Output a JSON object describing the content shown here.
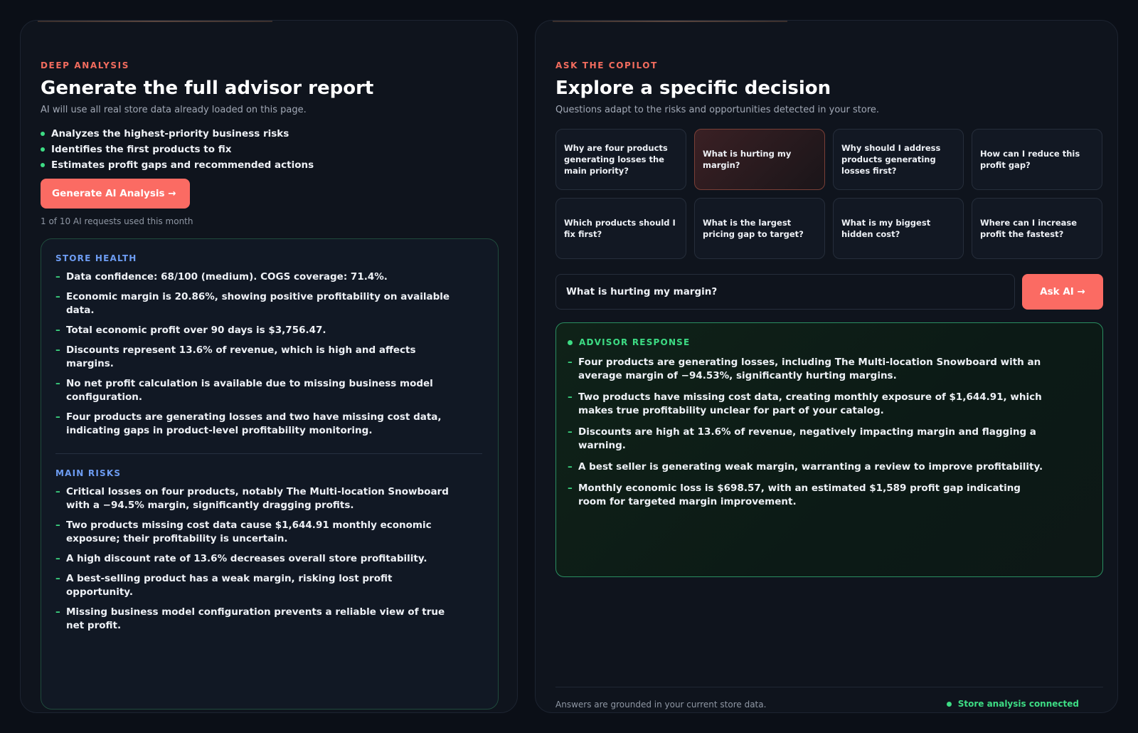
{
  "report": {
    "eyebrow": "DEEP ANALYSIS",
    "title": "Generate the full advisor report",
    "subtitle": "AI will use all real store data already loaded on this page.",
    "bullets": [
      "Analyzes the highest-priority business risks",
      "Identifies the first products to fix",
      "Estimates profit gaps and recommended actions"
    ],
    "generate_label": "Generate AI Analysis →",
    "usage": "1 of 10 AI requests used this month",
    "store_health": {
      "title": "STORE HEALTH",
      "items": [
        "Data confidence: 68/100 (medium). COGS coverage: 71.4%.",
        "Economic margin is 20.86%, showing positive profitability on available data.",
        "Total economic profit over 90 days is $3,756.47.",
        "Discounts represent 13.6% of revenue, which is high and affects margins.",
        "No net profit calculation is available due to missing business model configuration.",
        "Four products are generating losses and two have missing cost data, indicating gaps in product-level profitability monitoring."
      ]
    },
    "main_risks": {
      "title": "MAIN RISKS",
      "items": [
        "Critical losses on four products, notably The Multi-location Snowboard with a −94.5% margin, significantly dragging profits.",
        "Two products missing cost data cause $1,644.91 monthly economic exposure; their profitability is uncertain.",
        "A high discount rate of 13.6% decreases overall store profitability.",
        "A best-selling product has a weak margin, risking lost profit opportunity.",
        "Missing business model configuration prevents a reliable view of true net profit."
      ]
    }
  },
  "copilot": {
    "eyebrow": "ASK THE COPILOT",
    "title": "Explore a specific decision",
    "subtitle": "Questions adapt to the risks and opportunities detected in your store.",
    "questions": [
      "Why are four products generating losses the main priority?",
      "What is hurting my margin?",
      "Why should I address products generating losses first?",
      "How can I reduce this profit gap?",
      "Which products should I fix first?",
      "What is the largest pricing gap to target?",
      "What is my biggest hidden cost?",
      "Where can I increase profit the fastest?"
    ],
    "selected_index": 1,
    "input_value": "What is hurting my margin?",
    "ask_label": "Ask AI →",
    "response": {
      "title": "ADVISOR RESPONSE",
      "items": [
        "Four products are generating losses, including The Multi-location Snowboard with an average margin of −94.53%, significantly hurting margins.",
        "Two products have missing cost data, creating monthly exposure of $1,644.91, which makes true profitability unclear for part of your catalog.",
        "Discounts are high at 13.6% of revenue, negatively impacting margin and flagging a warning.",
        "A best seller is generating weak margin, warranting a review to improve profitability.",
        "Monthly economic loss is $698.57, with an estimated $1,589 profit gap indicating room for targeted margin improvement."
      ]
    },
    "footer_note": "Answers are grounded in your current store data.",
    "status": "Store analysis connected"
  },
  "colors": {
    "accent": "#fb6b63",
    "success": "#3ddc84",
    "section_blue": "#6d9cf2",
    "background": "#0b0f17"
  }
}
